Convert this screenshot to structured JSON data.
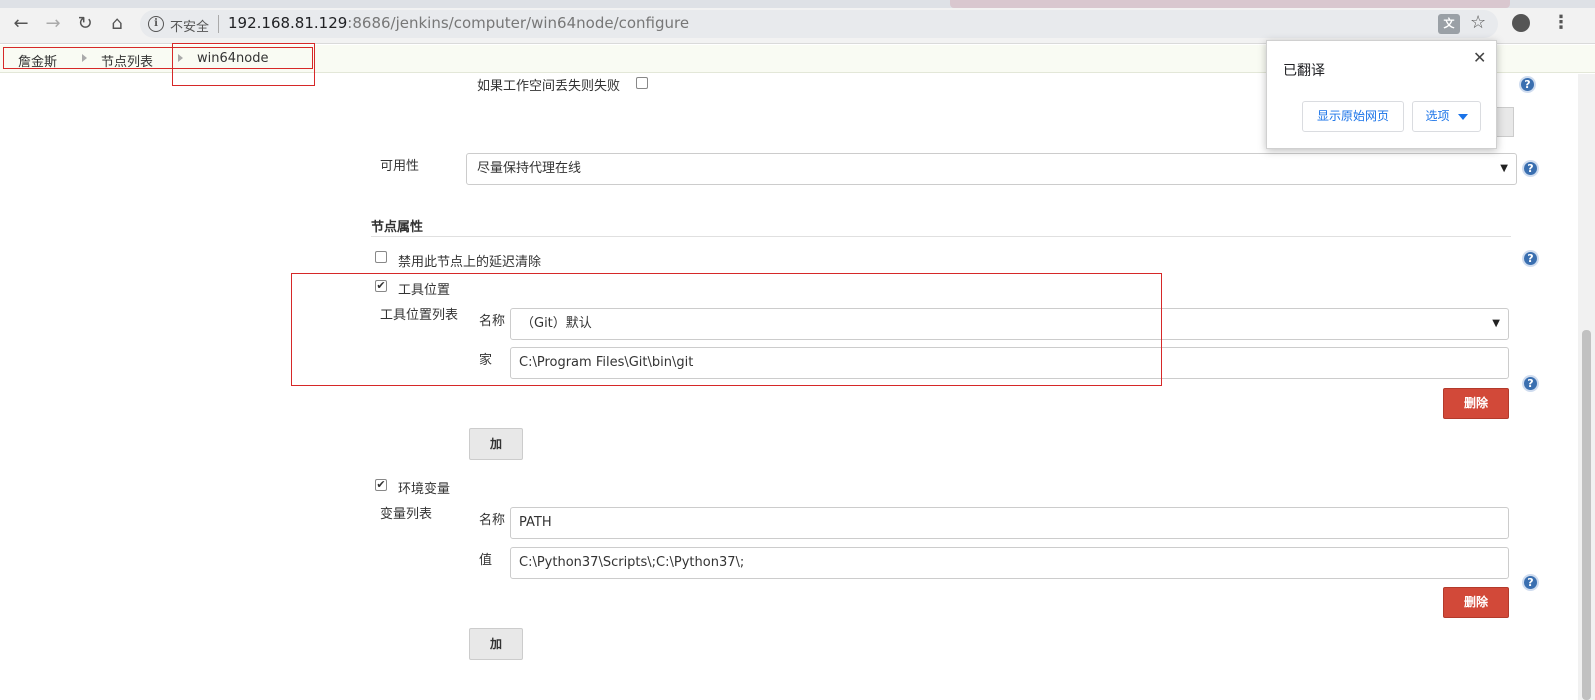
{
  "browser": {
    "insecure_label": "不安全",
    "url_host": "192.168.81.129",
    "url_rest": ":8686/jenkins/computer/win64node/configure"
  },
  "breadcrumb": {
    "items": [
      "詹金斯",
      "节点列表",
      "win64node"
    ]
  },
  "form": {
    "fail_workspace_label": "如果工作空间丢失则失败",
    "availability_label": "可用性",
    "availability_value": "尽量保持代理在线",
    "node_props_title": "节点属性",
    "disable_cleanup_label": "禁用此节点上的延迟清除",
    "tool_locations_label": "工具位置",
    "tool_list_label": "工具位置列表",
    "tool_name_label": "名称",
    "tool_name_value": "（Git）默认",
    "tool_home_label": "家",
    "tool_home_value": "C:\\Program Files\\Git\\bin\\git",
    "delete_label": "删除",
    "add_label": "加",
    "env_vars_label": "环境变量",
    "var_list_label": "变量列表",
    "var_name_label": "名称",
    "var_name_value": "PATH",
    "var_value_label": "值",
    "var_value_value": "C:\\Python37\\Scripts\\;C:\\Python37\\;",
    "help_glyph": "?"
  },
  "translate_popup": {
    "title": "已翻译",
    "show_original": "显示原始网页",
    "options": "选项"
  },
  "colors": {
    "delete_button": "#d24939",
    "help_icon": "#3a6fb0",
    "annotation": "#d62828"
  }
}
